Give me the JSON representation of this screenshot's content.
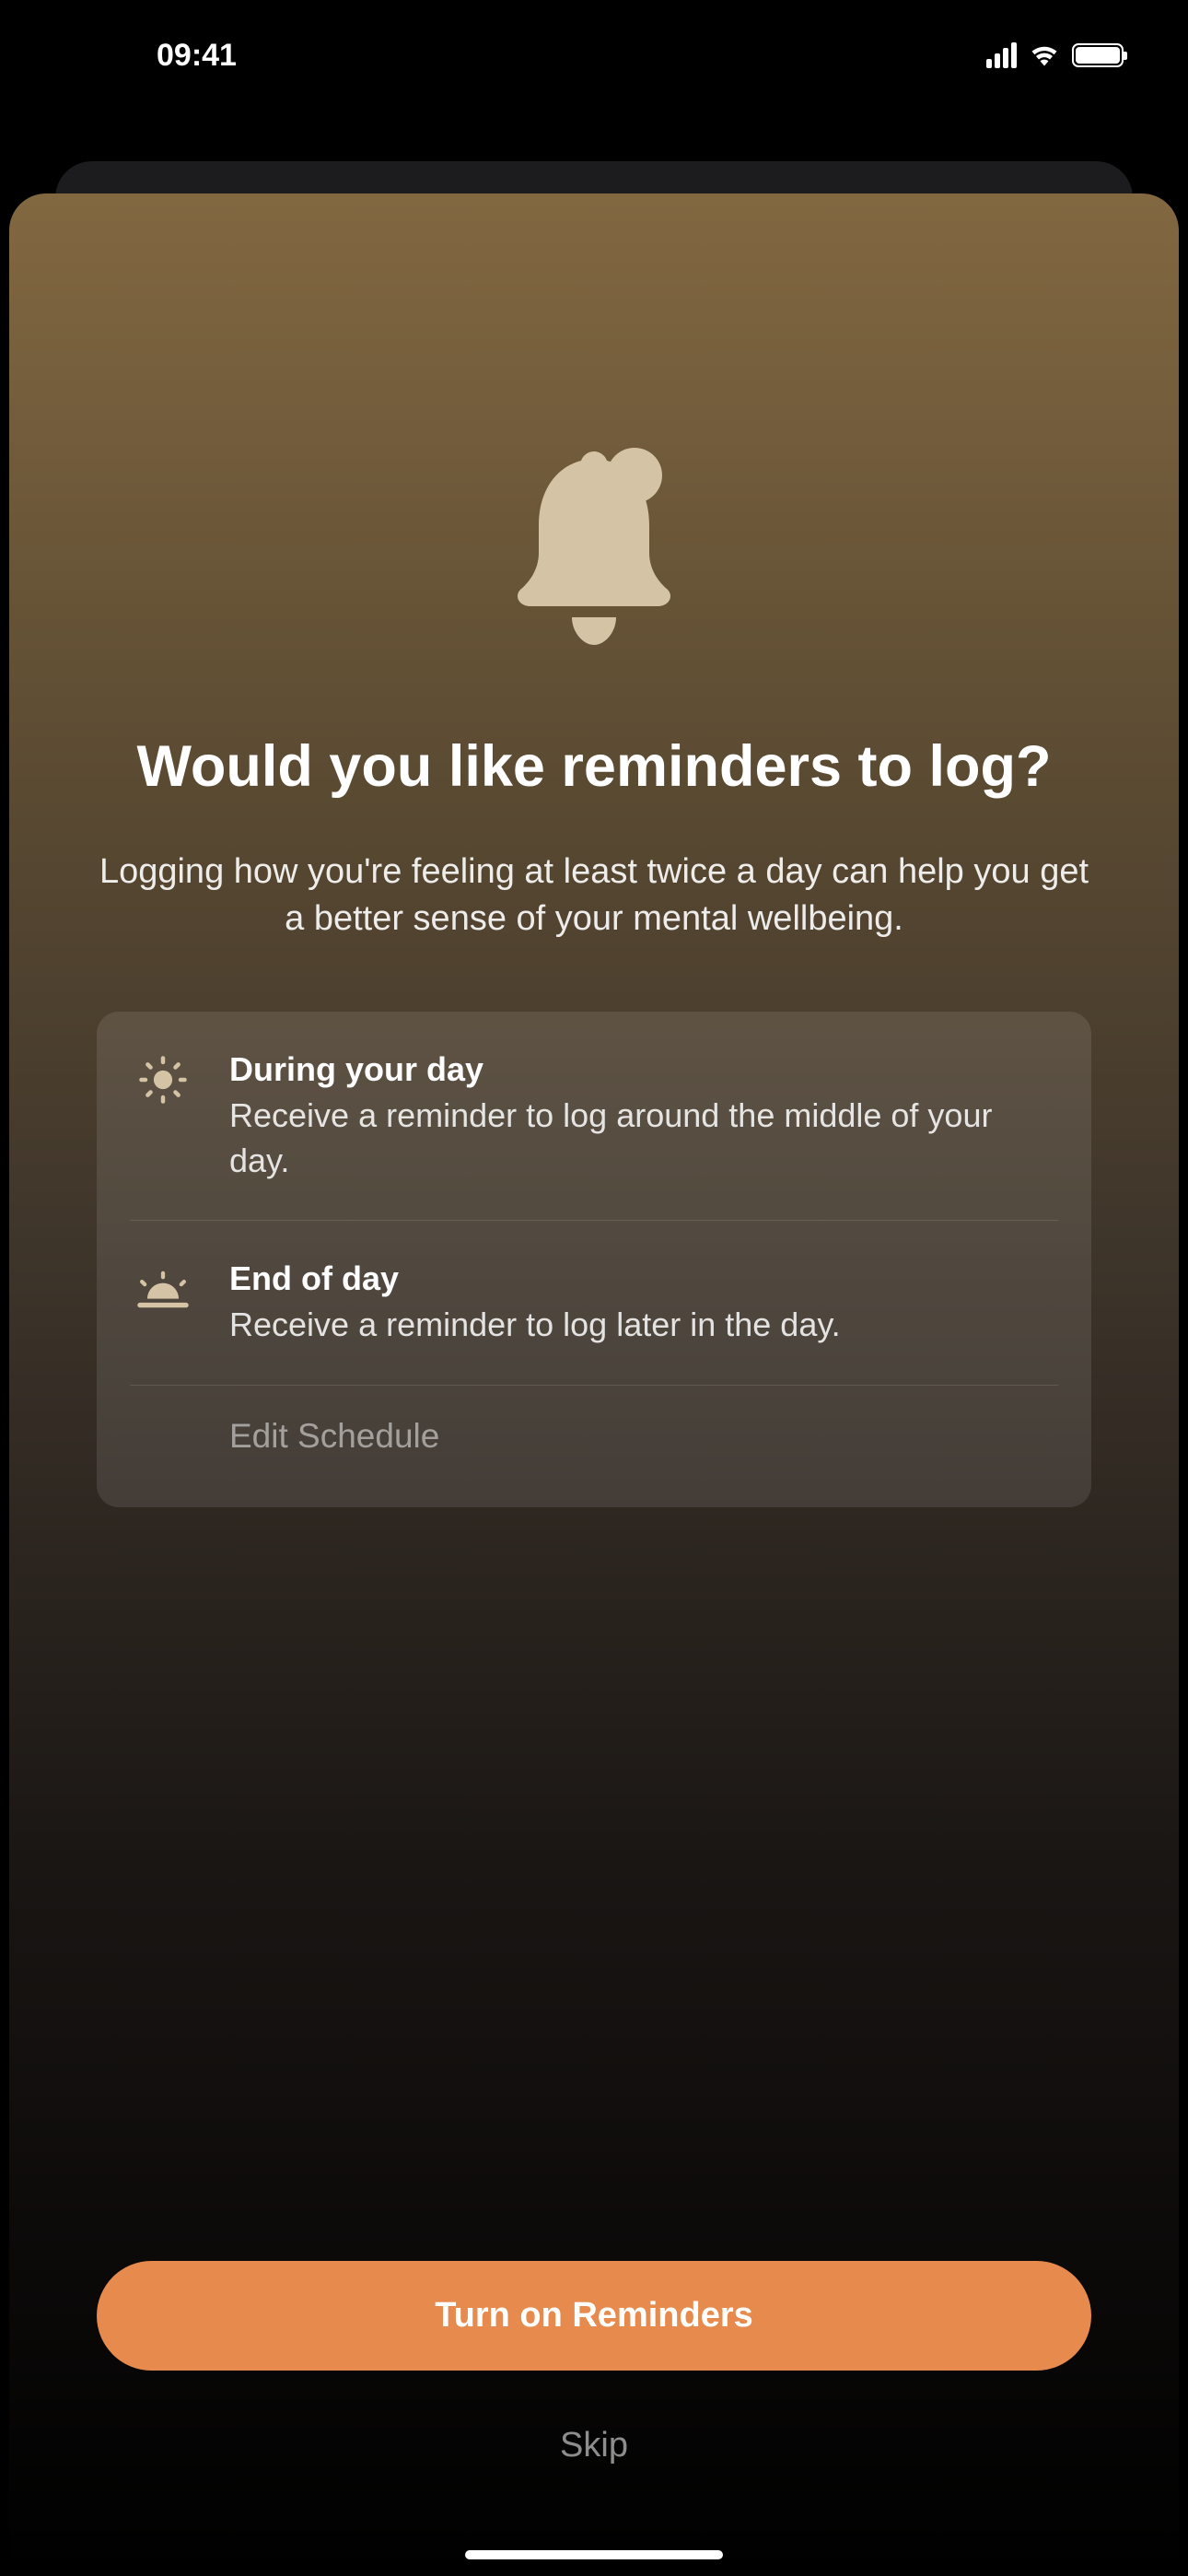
{
  "status": {
    "time": "09:41"
  },
  "heading": "Would you like reminders to log?",
  "subheading": "Logging how you're feeling at least twice a day can help you get a better sense of your mental wellbeing.",
  "reminders": [
    {
      "icon": "sun-icon",
      "title": "During your day",
      "desc": "Receive a reminder to log around the middle of your day."
    },
    {
      "icon": "sunset-icon",
      "title": "End of day",
      "desc": "Receive a reminder to log later in the day."
    }
  ],
  "editLabel": "Edit Schedule",
  "primaryButton": "Turn on Reminders",
  "skipButton": "Skip"
}
